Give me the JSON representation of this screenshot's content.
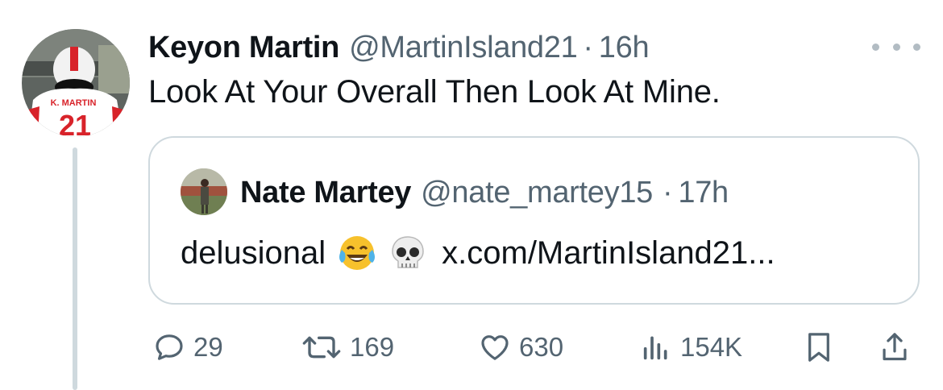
{
  "tweet": {
    "author_name": "Keyon Martin",
    "handle": "@MartinIsland21",
    "separator": "·",
    "time": "16h",
    "text": "Look At Your Overall Then Look At Mine.",
    "avatar_jersey_text": "K. MARTIN",
    "avatar_number": "21"
  },
  "quote": {
    "author_name": "Nate Martey",
    "handle": "@nate_martey15",
    "separator": "·",
    "time": "17h",
    "text": "delusional",
    "emojis": [
      "face-with-tears-of-joy",
      "skull"
    ],
    "link": "x.com/MartinIsland21..."
  },
  "actions": {
    "replies": "29",
    "reposts": "169",
    "likes": "630",
    "views": "154K"
  },
  "colors": {
    "text": "#0f1419",
    "secondary": "#536471",
    "border": "#cfd9de"
  },
  "icons": [
    "more-icon",
    "reply-icon",
    "repost-icon",
    "like-icon",
    "views-icon",
    "bookmark-icon",
    "share-icon"
  ]
}
